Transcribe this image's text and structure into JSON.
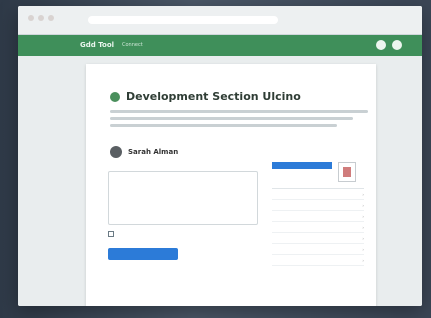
{
  "browser": {
    "address_text": "",
    "window_dot_colors": [
      "#d9d3d1",
      "#d9d3d1",
      "#d9d3d1"
    ]
  },
  "app": {
    "brand": "Gdd Tool",
    "brand_sub": "Connect",
    "header_small": "",
    "header_icons": [
      "menu-icon",
      "search-icon",
      "user-icon"
    ]
  },
  "main": {
    "title": "Development Section Ulcino",
    "description": [
      "",
      "",
      ""
    ],
    "profile": {
      "name": "Sarah Alman",
      "subtitle": ""
    },
    "textarea": {
      "value": "",
      "placeholder": ""
    },
    "checkbox_label": "",
    "submit_label": ""
  },
  "right_panel": {
    "title": "",
    "rows": [
      {
        "label": "",
        "value": ""
      },
      {
        "label": "",
        "value": ""
      }
    ],
    "link_text": "",
    "selected_value": "",
    "list": [
      {
        "label": ""
      },
      {
        "label": ""
      },
      {
        "label": ""
      },
      {
        "label": ""
      },
      {
        "label": ""
      },
      {
        "label": ""
      },
      {
        "label": ""
      }
    ]
  },
  "colors": {
    "appbar": "#3f8f5a",
    "primary": "#2c7bd8",
    "card_bg": "#ffffff"
  }
}
